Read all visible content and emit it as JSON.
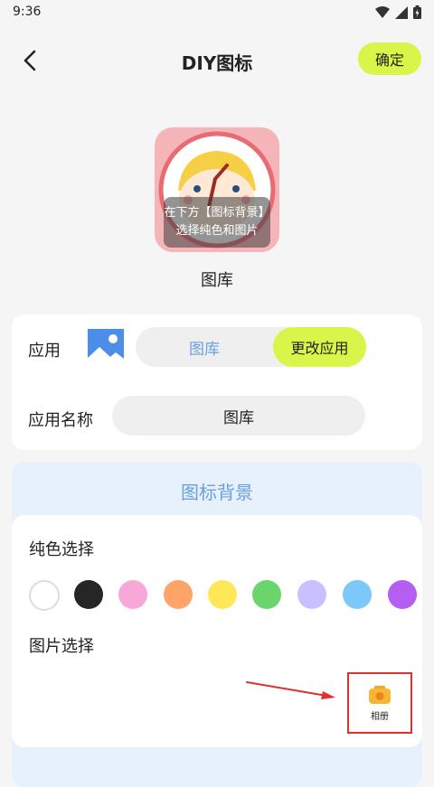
{
  "status": {
    "time": "9:36"
  },
  "header": {
    "title": "DIY图标",
    "confirm_label": "确定"
  },
  "preview": {
    "overlay_line1": "在下方【图标背景】",
    "overlay_line2": "选择纯色和图片",
    "name": "图库"
  },
  "app_card": {
    "app_label": "应用",
    "current_app": "图库",
    "change_label": "更改应用",
    "name_label": "应用名称",
    "name_value": "图库"
  },
  "background": {
    "section_title": "图标背景",
    "solid_heading": "纯色选择",
    "swatches": [
      "#ffffff",
      "#262626",
      "#f7a8d8",
      "#ffa468",
      "#ffe75a",
      "#6ad46d",
      "#c8c0ff",
      "#7cc8fa",
      "#b45ef2"
    ],
    "image_heading": "图片选择",
    "album_label": "相册"
  },
  "colors": {
    "accent": "#d9f54a",
    "link_blue": "#6a9fe0",
    "highlight_red": "#e03030"
  }
}
